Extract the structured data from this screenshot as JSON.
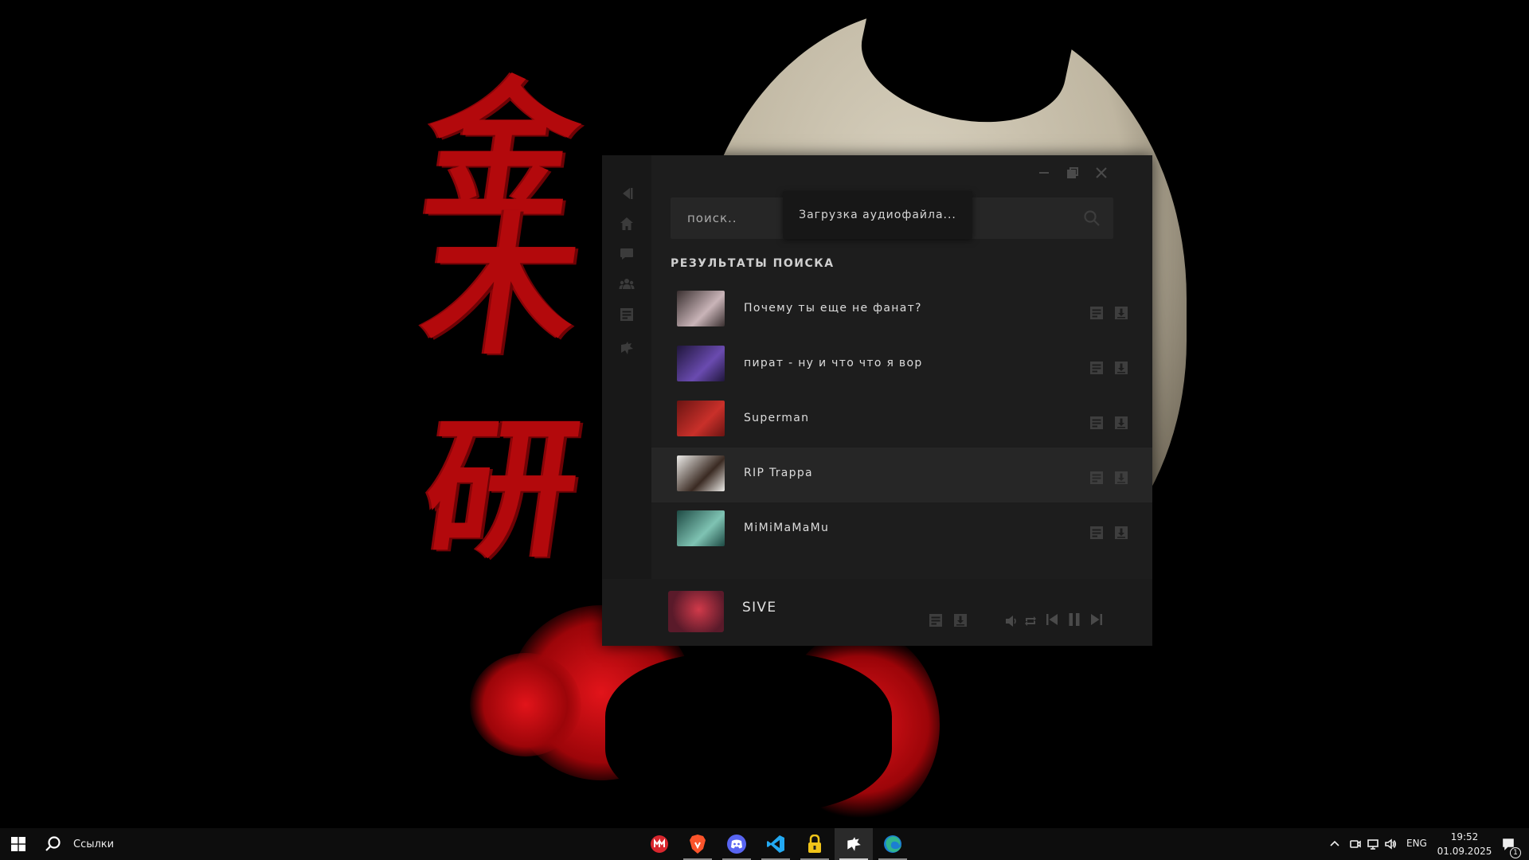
{
  "wallpaper": {
    "kanji": [
      "金",
      "木",
      "研"
    ]
  },
  "app": {
    "search": {
      "placeholder": "поиск.."
    },
    "loading_message": "Загрузка аудиофайла...",
    "results_title": "РЕЗУЛЬТАТЫ ПОИСКА",
    "results": [
      {
        "title": "Почему ты еще не фанат?",
        "thumb_colors": [
          "#3a3030",
          "#c9b4b8"
        ]
      },
      {
        "title": "пират - ну и что что я вор",
        "thumb_colors": [
          "#20163c",
          "#6a4bb0"
        ]
      },
      {
        "title": "Superman",
        "thumb_colors": [
          "#6b1412",
          "#c9302a"
        ]
      },
      {
        "title": "RIP Trappa",
        "thumb_colors": [
          "#ecebe8",
          "#3a2a22"
        ]
      },
      {
        "title": "MiMiMaMaMu",
        "thumb_colors": [
          "#1e4a44",
          "#7fc3b3"
        ]
      }
    ],
    "now_playing": {
      "title": "SIVE",
      "cover_colors": [
        "#5a1a2a",
        "#d13a4a"
      ]
    }
  },
  "taskbar": {
    "search_label": "Ссылки",
    "apps": [
      {
        "name": "mega",
        "color": "#d9272e"
      },
      {
        "name": "brave",
        "color": "#fb542b"
      },
      {
        "name": "discord",
        "color": "#5865f2"
      },
      {
        "name": "vscode",
        "color": "#23a9f2"
      },
      {
        "name": "vpn",
        "color": "#f0c419"
      },
      {
        "name": "music-app",
        "color": "#ffffff"
      },
      {
        "name": "edge",
        "color": "#2fb58d"
      }
    ],
    "language": "ENG",
    "time": "19:52",
    "date": "01.09.2025",
    "notifications": "1"
  }
}
